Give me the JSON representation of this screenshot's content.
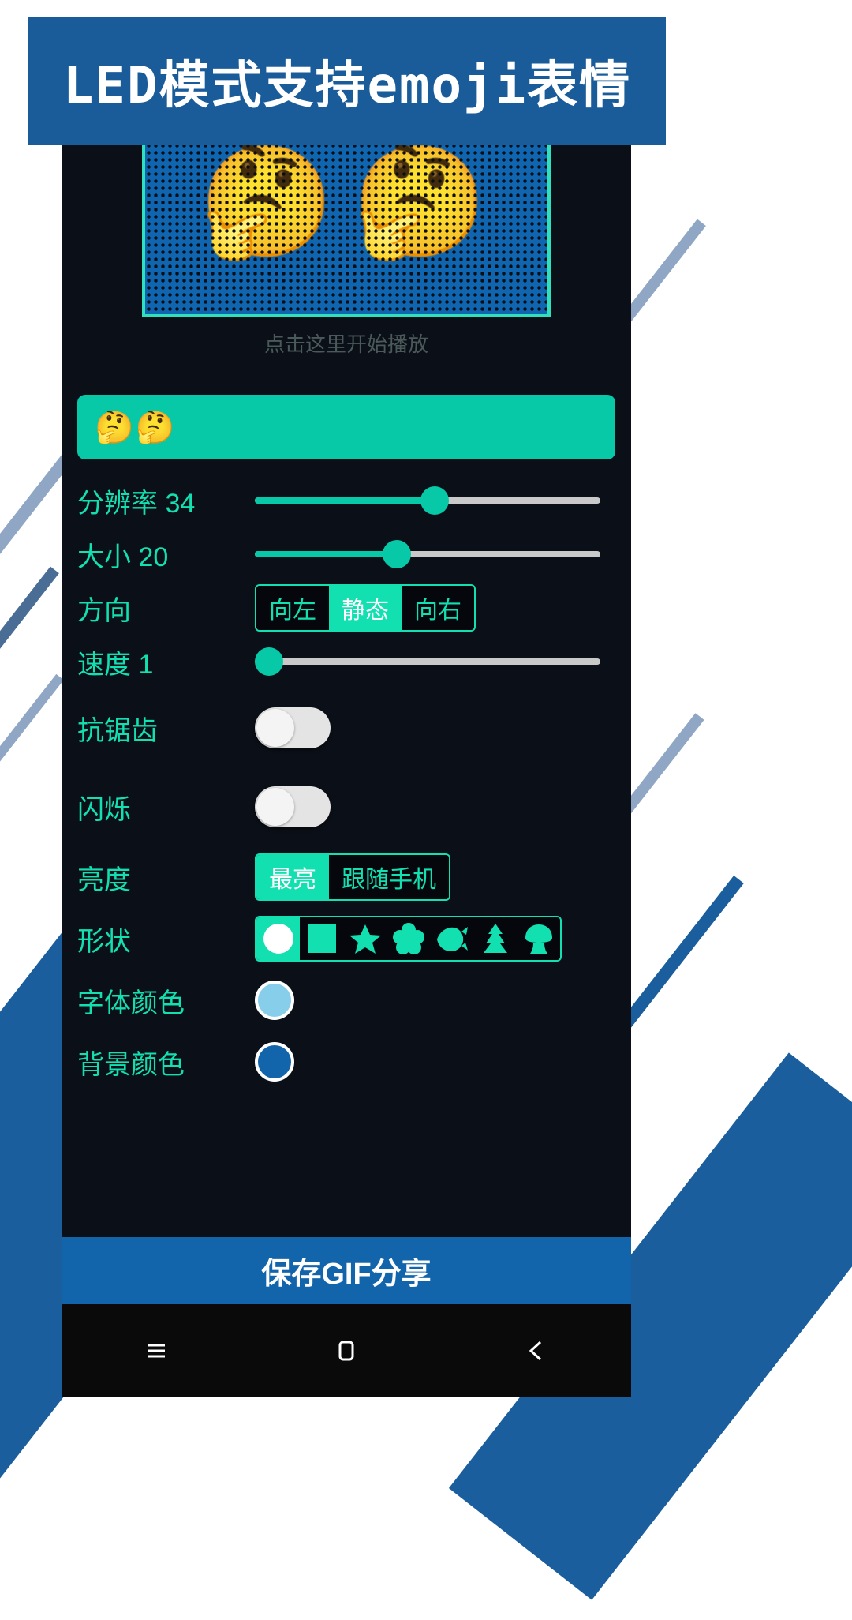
{
  "banner": {
    "title": "LED模式支持emoji表情"
  },
  "preview": {
    "emoji": "🤔",
    "emoji_count": 2,
    "play_hint": "点击这里开始播放",
    "panel_bg_color": "#1065b0",
    "panel_border_color": "#2fe0bd"
  },
  "input": {
    "value": "🤔🤔",
    "placeholder": "",
    "bg_color": "#07c9a7"
  },
  "settings": {
    "resolution": {
      "label": "分辨率 34",
      "name": "分辨率",
      "value": 34,
      "percent": 52
    },
    "size": {
      "label": "大小 20",
      "name": "大小",
      "value": 20,
      "percent": 41
    },
    "direction": {
      "label": "方向",
      "options": [
        "向左",
        "静态",
        "向右"
      ],
      "selected": "静态"
    },
    "speed": {
      "label": "速度 1",
      "name": "速度",
      "value": 1,
      "percent": 2
    },
    "antialias": {
      "label": "抗锯齿",
      "value": "off"
    },
    "blink": {
      "label": "闪烁",
      "value": "off"
    },
    "brightness": {
      "label": "亮度",
      "options": [
        "最亮",
        "跟随手机"
      ],
      "selected": "最亮"
    },
    "shape": {
      "label": "形状",
      "options": [
        "circle",
        "square",
        "star",
        "clover",
        "fish",
        "tree",
        "mushroom"
      ],
      "selected": "circle"
    },
    "font_color": {
      "label": "字体颜色",
      "color": "#87ceeb"
    },
    "bg_color": {
      "label": "背景颜色",
      "color": "#1265ab"
    }
  },
  "save_bar": {
    "label": "保存GIF分享"
  },
  "nav_bar": {
    "items": [
      {
        "name": "recents-icon",
        "glyph": "☰"
      },
      {
        "name": "home-icon",
        "glyph": "▢"
      },
      {
        "name": "back-icon",
        "glyph": "‹"
      }
    ]
  },
  "colors": {
    "accent": "#12e0b0",
    "brand_blue": "#1a5c99",
    "panel_bg": "#0b0f17"
  }
}
